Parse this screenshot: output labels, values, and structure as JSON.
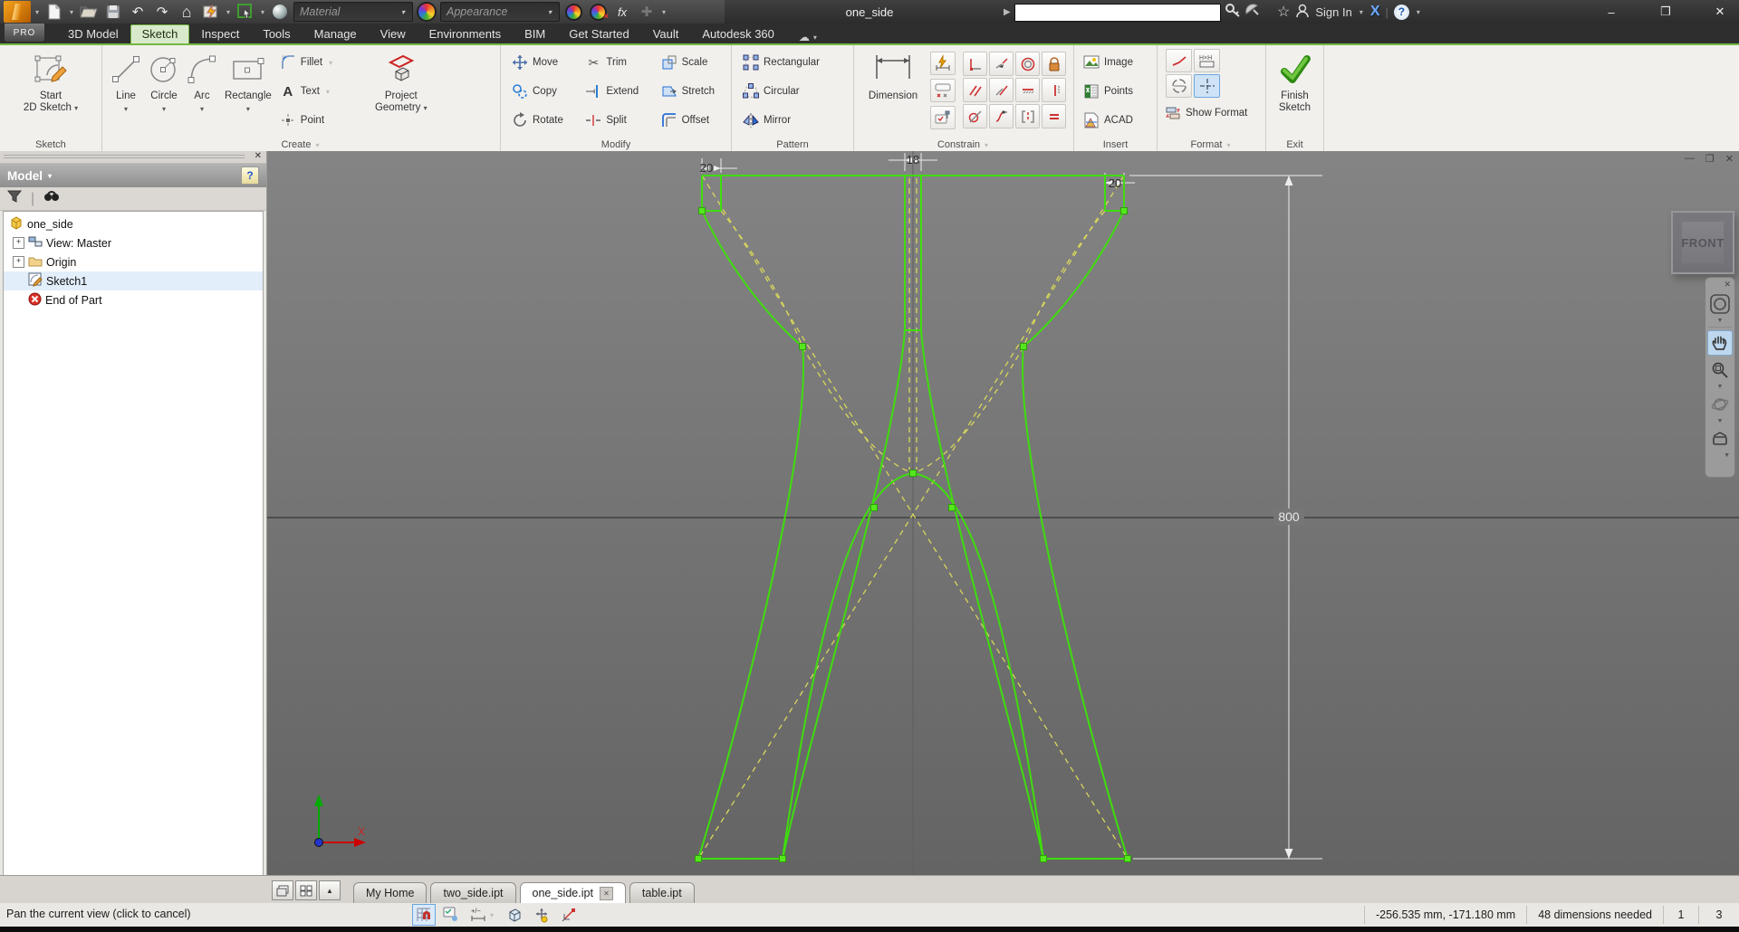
{
  "titlebar": {
    "document_title": "one_side",
    "material_label": "Material",
    "appearance_label": "Appearance",
    "fx_label": "fx",
    "sign_in_label": "Sign In",
    "pro_badge": "PRO"
  },
  "icons": {
    "undo": "↶",
    "redo": "↷",
    "home": "⌂",
    "cloud": "☁",
    "star": "☆",
    "trim_scissors": "✂",
    "minimize": "–",
    "maximize": "❐",
    "close": "✕",
    "help": "?",
    "exchange_x": "X"
  },
  "ribbon_tabs": [
    "3D Model",
    "Sketch",
    "Inspect",
    "Tools",
    "Manage",
    "View",
    "Environments",
    "BIM",
    "Get Started",
    "Vault",
    "Autodesk 360"
  ],
  "panels": {
    "sketch": {
      "label": "Sketch",
      "start_line1": "Start",
      "start_line2": "2D Sketch"
    },
    "create": {
      "label": "Create",
      "line": "Line",
      "circle": "Circle",
      "arc": "Arc",
      "rectangle": "Rectangle",
      "fillet": "Fillet",
      "text": "Text",
      "point": "Point",
      "project_line1": "Project",
      "project_line2": "Geometry"
    },
    "modify": {
      "label": "Modify",
      "move": "Move",
      "copy": "Copy",
      "rotate": "Rotate",
      "trim": "Trim",
      "extend": "Extend",
      "split": "Split",
      "scale": "Scale",
      "stretch": "Stretch",
      "offset": "Offset"
    },
    "pattern": {
      "label": "Pattern",
      "rectangular": "Rectangular",
      "circular": "Circular",
      "mirror": "Mirror"
    },
    "constrain": {
      "label": "Constrain",
      "dimension": "Dimension"
    },
    "insert": {
      "label": "Insert",
      "image": "Image",
      "points": "Points",
      "acad": "ACAD"
    },
    "format": {
      "label": "Format",
      "show_format": "Show Format",
      "hxh": "HxH"
    },
    "exit": {
      "label": "Exit",
      "finish_line1": "Finish",
      "finish_line2": "Sketch"
    }
  },
  "browser": {
    "title": "Model",
    "tree": [
      "one_side",
      "View: Master",
      "Origin",
      "Sketch1",
      "End of Part"
    ]
  },
  "canvas": {
    "viewcube_face": "FRONT",
    "dim_top_left": "20",
    "dim_top_center": "18",
    "dim_top_right": "20",
    "dim_height": "800",
    "axis_x_label": "X"
  },
  "doc_tabs": [
    "My Home",
    "two_side.ipt",
    "one_side.ipt",
    "table.ipt"
  ],
  "statusbar": {
    "message": "Pan the current view (click to cancel)",
    "coords": "-256.535 mm, -171.180 mm",
    "dims_needed": "48 dimensions needed",
    "num1": "1",
    "num2": "3"
  },
  "colors": {
    "accent_green": "#74b843",
    "sketch_green": "#3fdd0e",
    "construction_yellow": "#d8d75c"
  }
}
